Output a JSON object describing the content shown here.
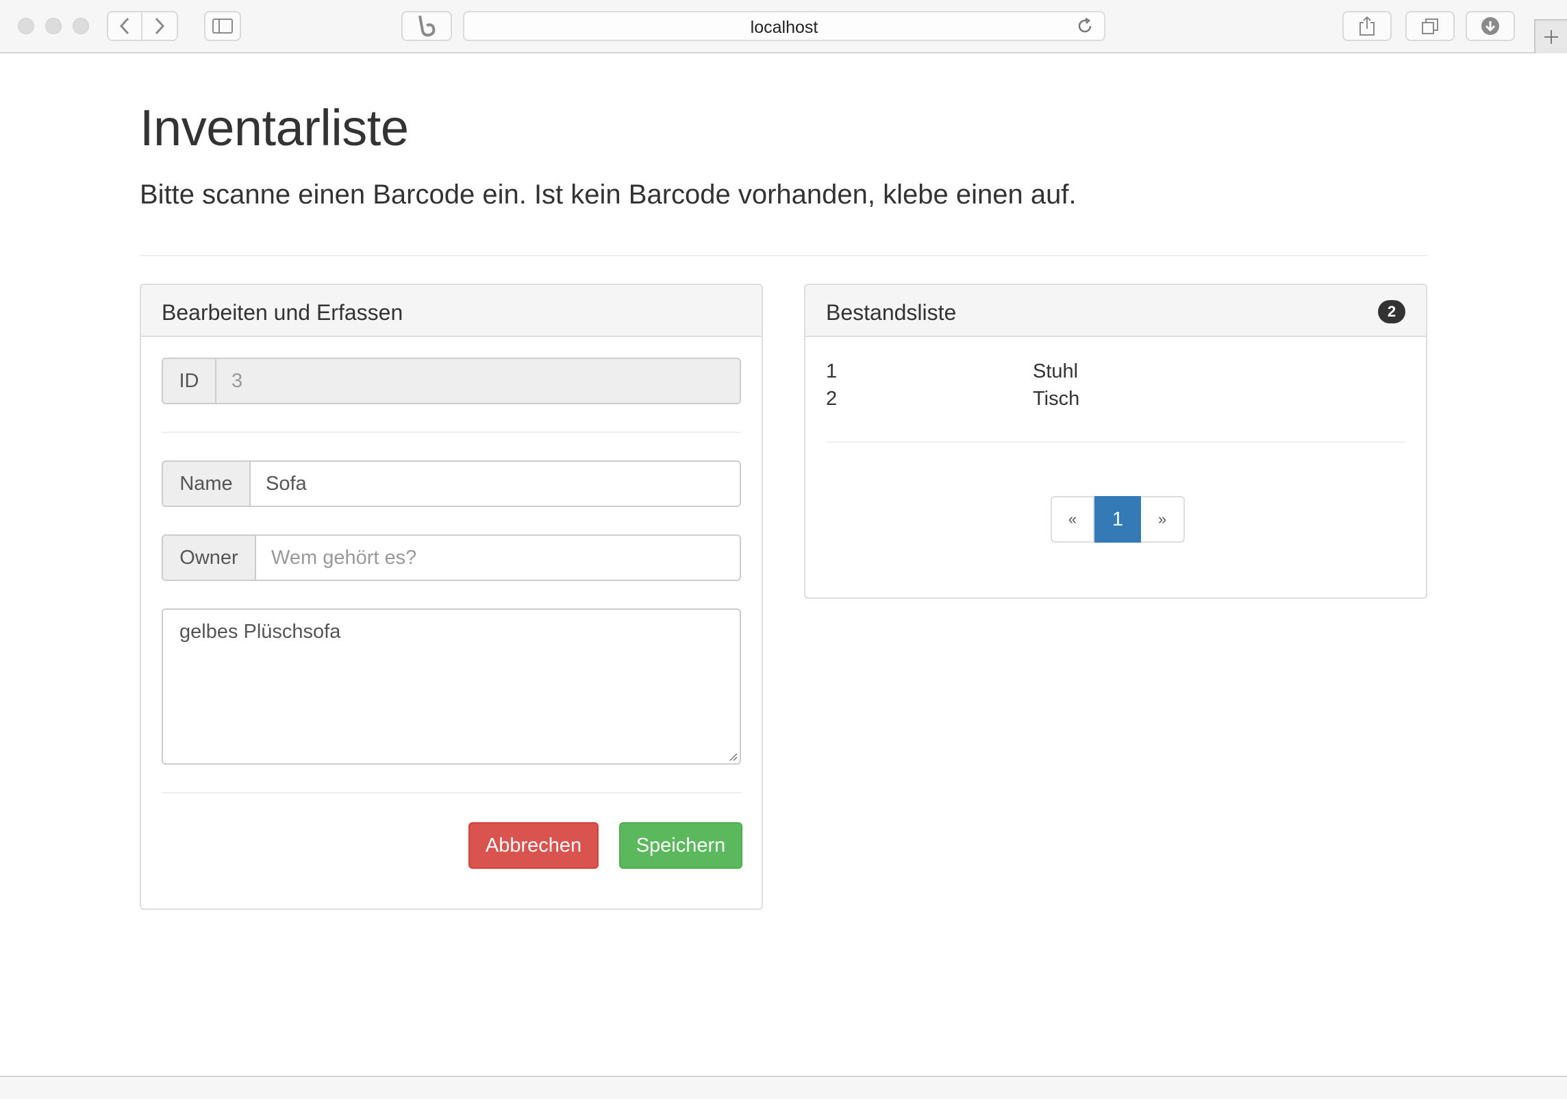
{
  "browser": {
    "url": "localhost"
  },
  "page": {
    "title": "Inventarliste",
    "lead": "Bitte scanne einen Barcode ein. Ist kein Barcode vorhanden, klebe einen auf."
  },
  "edit_panel": {
    "title": "Bearbeiten und Erfassen",
    "id_label": "ID",
    "id_value": "3",
    "name_label": "Name",
    "name_value": "Sofa",
    "owner_label": "Owner",
    "owner_placeholder": "Wem gehört es?",
    "description_value": "gelbes Plüschsofa",
    "cancel_label": "Abbrechen",
    "save_label": "Speichern"
  },
  "list_panel": {
    "title": "Bestandsliste",
    "count": "2",
    "items": [
      {
        "id": "1",
        "name": "Stuhl"
      },
      {
        "id": "2",
        "name": "Tisch"
      }
    ],
    "pagination": {
      "prev": "«",
      "current": "1",
      "next": "»"
    }
  },
  "colors": {
    "danger": "#d9534f",
    "success": "#5cb85c",
    "primary": "#337ab7"
  }
}
